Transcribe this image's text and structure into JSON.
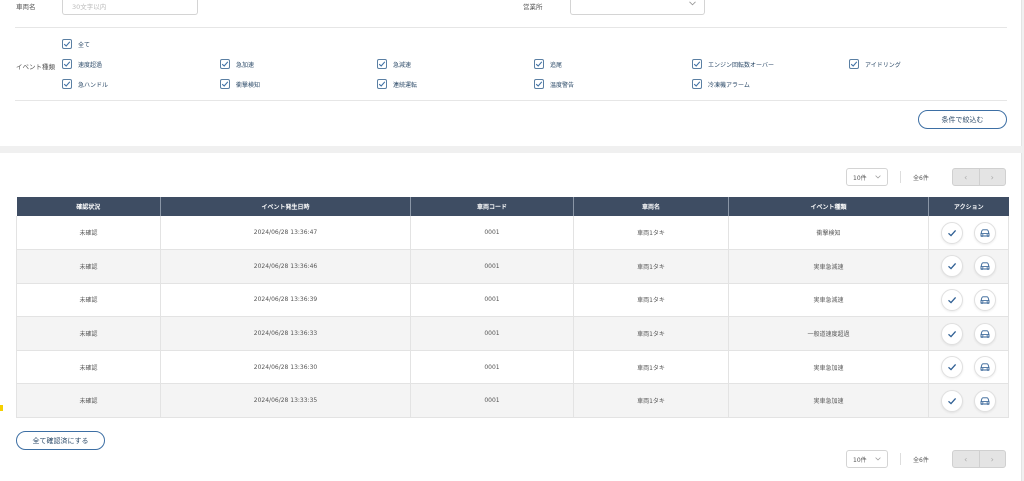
{
  "filters": {
    "vehicle_name_label": "車両名",
    "vehicle_name_placeholder": "30文字以内",
    "office_label": "営業所",
    "office_value": "",
    "event_type_label": "イベント種類",
    "all_label": "全て",
    "events": [
      "速度超過",
      "急加速",
      "急減速",
      "追尾",
      "エンジン回転数オーバー",
      "アイドリング",
      "急ハンドル",
      "衝撃検知",
      "連続運転",
      "温度警告",
      "冷凍機アラーム"
    ],
    "apply_button": "条件で絞込む"
  },
  "pager": {
    "per_page": "10件",
    "total": "全6件"
  },
  "table": {
    "headers": [
      "確認状況",
      "イベント発生日時",
      "車両コード",
      "車両名",
      "イベント種類",
      "アクション"
    ],
    "rows": [
      {
        "status": "未確認",
        "datetime": "2024/06/28 13:36:47",
        "code": "0001",
        "name": "車両1タキ",
        "event": "衝撃検知"
      },
      {
        "status": "未確認",
        "datetime": "2024/06/28 13:36:46",
        "code": "0001",
        "name": "車両1タキ",
        "event": "実車急減速"
      },
      {
        "status": "未確認",
        "datetime": "2024/06/28 13:36:39",
        "code": "0001",
        "name": "車両1タキ",
        "event": "実車急減速"
      },
      {
        "status": "未確認",
        "datetime": "2024/06/28 13:36:33",
        "code": "0001",
        "name": "車両1タキ",
        "event": "一般道速度超過"
      },
      {
        "status": "未確認",
        "datetime": "2024/06/28 13:36:30",
        "code": "0001",
        "name": "車両1タキ",
        "event": "実車急加速"
      },
      {
        "status": "未確認",
        "datetime": "2024/06/28 13:33:35",
        "code": "0001",
        "name": "車両1タキ",
        "event": "実車急加速"
      }
    ]
  },
  "confirm_all_button": "全て確認済にする",
  "icons": {
    "check": "check-icon",
    "vehicle": "car-icon",
    "dropdown": "chevron-down-icon",
    "prev": "chevron-left-icon",
    "next": "chevron-right-icon"
  },
  "colors": {
    "header_bg": "#3e4d63",
    "accent": "#3d6fa4"
  }
}
